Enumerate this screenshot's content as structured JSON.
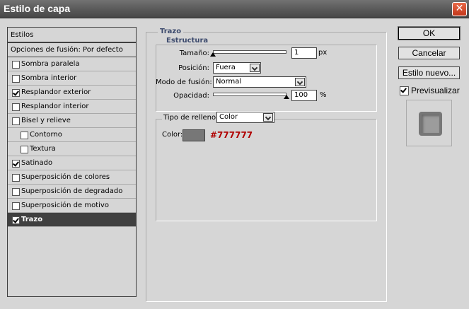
{
  "window": {
    "title": "Estilo de capa"
  },
  "stylelist": {
    "header": "Estilos",
    "blend": "Opciones de fusión: Por defecto",
    "items": [
      {
        "label": "Sombra paralela",
        "checked": false,
        "sub": false,
        "selected": false
      },
      {
        "label": "Sombra interior",
        "checked": false,
        "sub": false,
        "selected": false
      },
      {
        "label": "Resplandor exterior",
        "checked": true,
        "sub": false,
        "selected": false
      },
      {
        "label": "Resplandor interior",
        "checked": false,
        "sub": false,
        "selected": false
      },
      {
        "label": "Bisel y relieve",
        "checked": false,
        "sub": false,
        "selected": false
      },
      {
        "label": "Contorno",
        "checked": false,
        "sub": true,
        "selected": false
      },
      {
        "label": "Textura",
        "checked": false,
        "sub": true,
        "selected": false
      },
      {
        "label": "Satinado",
        "checked": true,
        "sub": false,
        "selected": false
      },
      {
        "label": "Superposición de colores",
        "checked": false,
        "sub": false,
        "selected": false
      },
      {
        "label": "Superposición de degradado",
        "checked": false,
        "sub": false,
        "selected": false
      },
      {
        "label": "Superposición de motivo",
        "checked": false,
        "sub": false,
        "selected": false
      },
      {
        "label": "Trazo",
        "checked": true,
        "sub": false,
        "selected": true
      }
    ]
  },
  "trazo": {
    "title": "Trazo",
    "estructura": {
      "title": "Estructura",
      "size_label": "Tamaño:",
      "size_value": "1",
      "size_unit": "px",
      "position_label": "Posición:",
      "position_value": "Fuera",
      "blend_label": "Modo de fusión:",
      "blend_value": "Normal",
      "opacity_label": "Opacidad:",
      "opacity_value": "100",
      "opacity_unit": "%",
      "size_fraction": 0,
      "opacity_fraction": 1.0
    },
    "fill": {
      "type_label": "Tipo de relleno:",
      "type_value": "Color",
      "color_label": "Color:",
      "color_hex": "#777777",
      "swatch_color": "#777777"
    }
  },
  "buttons": {
    "ok": "OK",
    "cancel": "Cancelar",
    "new_style": "Estilo nuevo...",
    "preview_label": "Previsualizar",
    "preview_checked": true
  }
}
